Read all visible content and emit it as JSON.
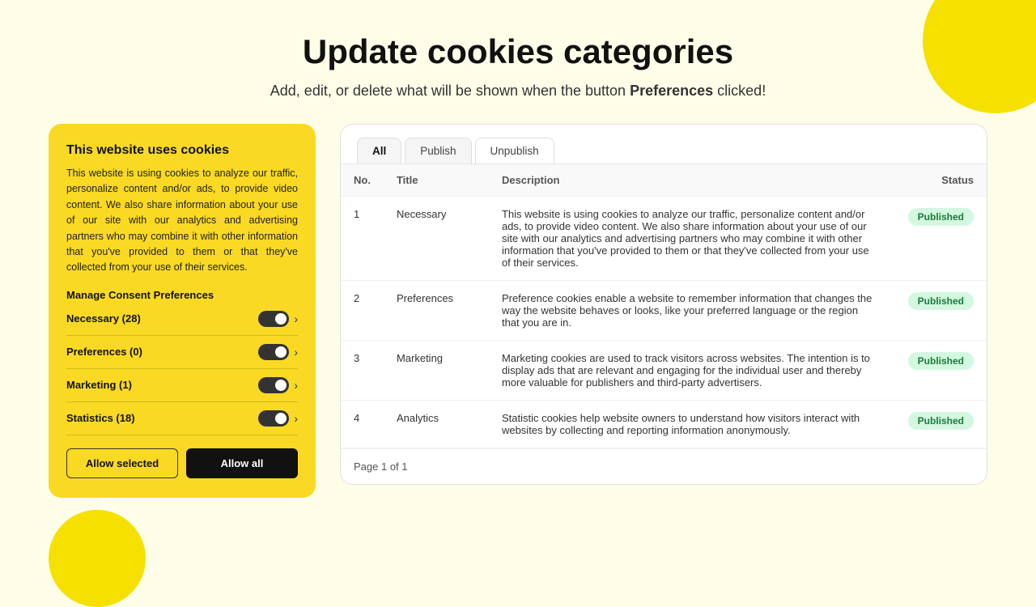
{
  "page": {
    "title": "Update cookies categories",
    "subtitle_prefix": "Add, edit, or delete what will be shown when the button",
    "subtitle_keyword": "Preferences",
    "subtitle_suffix": "clicked!"
  },
  "cookie_panel": {
    "title": "This website uses cookies",
    "description": "This website is using cookies to analyze our traffic, personalize content and/or ads, to provide video content. We also share information about your use of our site with our analytics and advertising partners who may combine it with other information that you've provided to them or that they've collected from your use of their services.",
    "manage_title": "Manage Consent Preferences",
    "items": [
      {
        "label": "Necessary (28)"
      },
      {
        "label": "Preferences (0)"
      },
      {
        "label": "Marketing (1)"
      },
      {
        "label": "Statistics (18)"
      }
    ],
    "btn_allow_selected": "Allow selected",
    "btn_allow_all": "Allow all"
  },
  "table": {
    "tabs": [
      {
        "label": "All"
      },
      {
        "label": "Publish"
      },
      {
        "label": "Unpublish"
      }
    ],
    "columns": {
      "no": "No.",
      "title": "Title",
      "description": "Description",
      "status": "Status"
    },
    "rows": [
      {
        "no": "1",
        "title": "Necessary",
        "description": "This website is using cookies to analyze our traffic, personalize content and/or ads, to provide video content. We also share information about your use of our site with our analytics and advertising partners who may combine it with other information that you've provided to them or that they've collected from your use of their services.",
        "status": "Published"
      },
      {
        "no": "2",
        "title": "Preferences",
        "description": "Preference cookies enable a website to remember information that changes the way the website behaves or looks, like your preferred language or the region that you are in.",
        "status": "Published"
      },
      {
        "no": "3",
        "title": "Marketing",
        "description": "Marketing cookies are used to track visitors across websites. The intention is to display ads that are relevant and engaging for the individual user and thereby more valuable for publishers and third-party advertisers.",
        "status": "Published"
      },
      {
        "no": "4",
        "title": "Analytics",
        "description": "Statistic cookies help website owners to understand how visitors interact with websites by collecting and reporting information anonymously.",
        "status": "Published"
      }
    ],
    "pagination": "Page 1 of 1"
  }
}
